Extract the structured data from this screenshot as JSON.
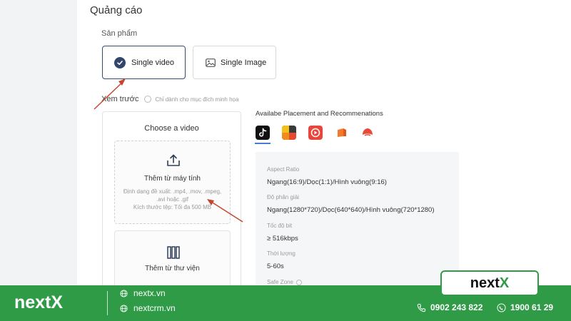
{
  "section_title": "Quảng cáo",
  "product": {
    "label": "Sản phẩm",
    "options": [
      {
        "label": "Single video",
        "selected": true
      },
      {
        "label": "Single Image",
        "selected": false
      }
    ]
  },
  "preview": {
    "label": "Xem trước",
    "note": "Chỉ dành cho mục đích minh họa"
  },
  "video_card": {
    "title": "Choose a video",
    "upload": {
      "title": "Thêm từ máy tính",
      "formats": "Định dạng đề xuất: .mp4, .mov, .mpeg, .avi hoặc .gif",
      "size": "Kích thước tệp: Tối đa 500 MB"
    },
    "library": {
      "title": "Thêm từ thư viện"
    }
  },
  "placements": {
    "title": "Availabe Placement and Recommenations",
    "icons": [
      "tiktok-icon",
      "buzzvideo-icon",
      "topbuzz-icon",
      "babe-icon",
      "pangle-icon"
    ],
    "specs": {
      "aspect_label": "Aspect Ratio",
      "aspect_value": "Ngang(16:9)/Dọc(1:1)/Hình vuông(9:16)",
      "resolution_label": "Độ phân giải",
      "resolution_value": "Ngang(1280*720)/Dọc(640*640)/Hình vuông(720*1280)",
      "bitrate_label": "Tốc độ bit",
      "bitrate_value": "≥ 516kbps",
      "duration_label": "Thời lượng",
      "duration_value": "5-60s",
      "safezone_label": "Safe Zone"
    }
  },
  "footer": {
    "logo": "nextX",
    "links": [
      "nextx.vn",
      "nextcrm.vn"
    ],
    "phones": [
      "0902 243 822",
      "1900 61 29"
    ],
    "badge_prefix": "next",
    "badge_suffix": "X"
  },
  "colors": {
    "brand_green": "#2f9b47",
    "selected_border": "#3b4a6b",
    "arrow_red": "#c8432b"
  }
}
